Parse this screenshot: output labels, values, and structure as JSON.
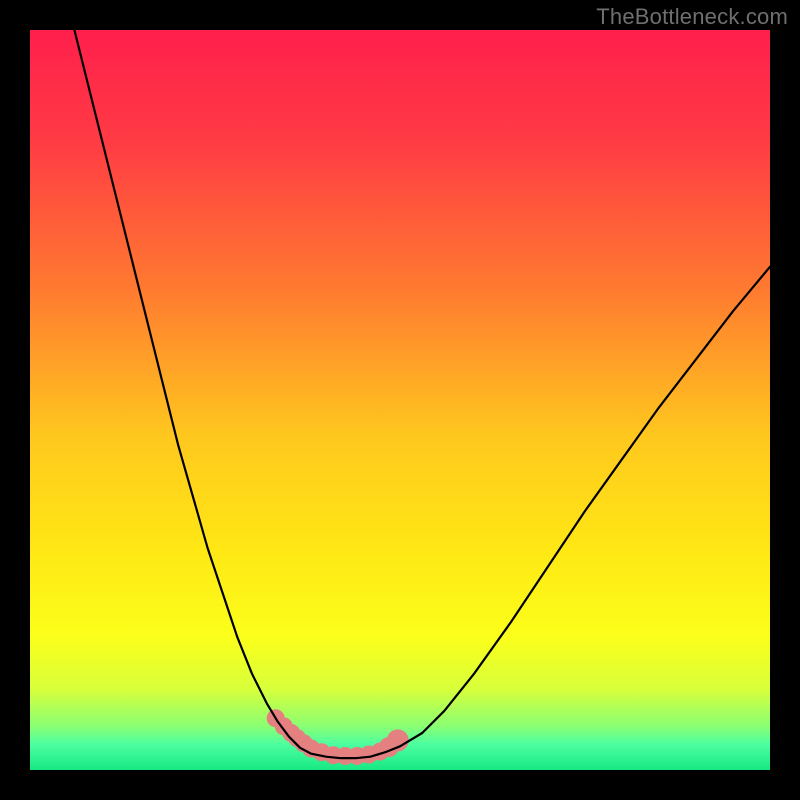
{
  "watermark": "TheBottleneck.com",
  "colors": {
    "frame": "#000000",
    "curve": "#000000",
    "marker_fill": "#e58080",
    "marker_stroke": "#e07878",
    "gradient_stops": [
      {
        "offset": 0.0,
        "color": "#ff1f4c"
      },
      {
        "offset": 0.15,
        "color": "#ff3b44"
      },
      {
        "offset": 0.35,
        "color": "#ff7a30"
      },
      {
        "offset": 0.55,
        "color": "#ffc81e"
      },
      {
        "offset": 0.7,
        "color": "#ffe714"
      },
      {
        "offset": 0.82,
        "color": "#fbff1a"
      },
      {
        "offset": 0.89,
        "color": "#d8ff3a"
      },
      {
        "offset": 0.94,
        "color": "#8cff72"
      },
      {
        "offset": 0.965,
        "color": "#4dffa0"
      },
      {
        "offset": 1.0,
        "color": "#17e884"
      }
    ]
  },
  "chart_data": {
    "type": "line",
    "title": "",
    "xlabel": "",
    "ylabel": "",
    "xlim": [
      0,
      100
    ],
    "ylim": [
      0,
      100
    ],
    "grid": false,
    "legend": false,
    "series": [
      {
        "name": "left-curve",
        "x": [
          6,
          8,
          10,
          12,
          14,
          16,
          18,
          20,
          22,
          24,
          26,
          28,
          30,
          32,
          33.5,
          35,
          36.5,
          38
        ],
        "y": [
          100,
          92,
          84,
          76,
          68,
          60,
          52,
          44,
          37,
          30,
          24,
          18,
          13,
          9,
          6.5,
          4.5,
          3,
          2.2
        ]
      },
      {
        "name": "floor",
        "x": [
          38,
          40,
          42,
          44,
          46,
          48
        ],
        "y": [
          2.2,
          1.8,
          1.6,
          1.6,
          1.8,
          2.4
        ]
      },
      {
        "name": "right-curve",
        "x": [
          48,
          50,
          53,
          56,
          60,
          65,
          70,
          75,
          80,
          85,
          90,
          95,
          100
        ],
        "y": [
          2.4,
          3.2,
          5,
          8,
          13,
          20,
          27.5,
          35,
          42,
          49,
          55.5,
          62,
          68
        ]
      }
    ],
    "markers": {
      "name": "highlight-dots",
      "x": [
        33.2,
        34.3,
        35.3,
        36.1,
        37.0,
        38.0,
        39.4,
        41.0,
        42.6,
        44.2,
        45.8,
        47.3,
        48.5,
        49.7
      ],
      "y": [
        7.0,
        5.9,
        5.0,
        4.3,
        3.6,
        2.9,
        2.4,
        2.0,
        1.9,
        1.9,
        2.1,
        2.5,
        3.1,
        4.0
      ],
      "r": [
        9,
        9,
        9,
        9,
        9,
        9,
        9,
        9,
        9,
        9,
        9,
        9,
        10,
        11
      ]
    }
  }
}
